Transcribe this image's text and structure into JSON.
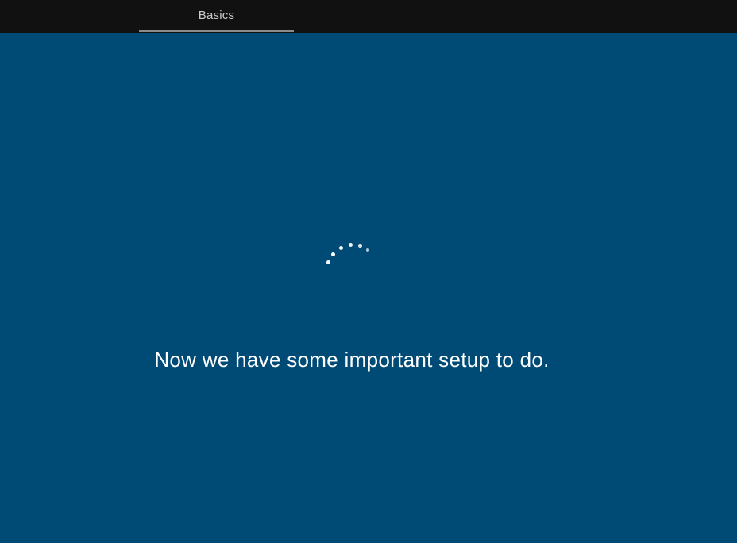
{
  "header": {
    "tab_label": "Basics"
  },
  "main": {
    "message": "Now we have some important setup to do."
  },
  "colors": {
    "background": "#004b75",
    "header_background": "#111111",
    "text": "#ffffff",
    "tab_text": "#cccccc",
    "tab_underline": "#8a8a8a"
  }
}
